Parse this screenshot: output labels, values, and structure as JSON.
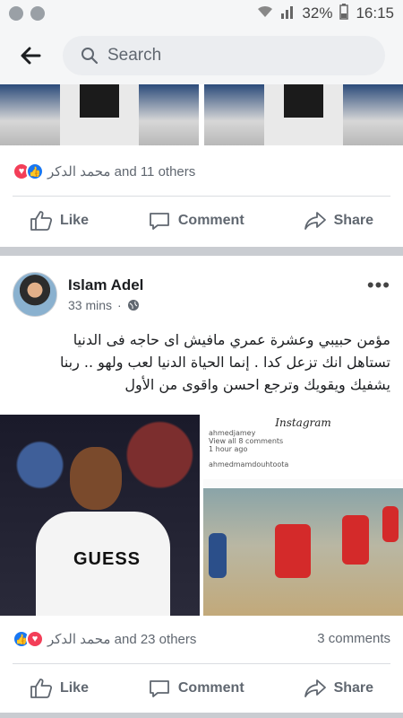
{
  "status_bar": {
    "battery": "32%",
    "time": "16:15"
  },
  "search": {
    "placeholder": "Search"
  },
  "post1": {
    "reactions_text": "محمد الدكر and 11 others"
  },
  "actions": {
    "like": "Like",
    "comment": "Comment",
    "share": "Share"
  },
  "post2": {
    "author": "Islam Adel",
    "time": "33 mins",
    "text_lines": [
      "مؤمن حبيبي وعشرة عمري مافيش اى حاجه فى الدنيا",
      "تستاهل انك تزعل كدا . إنما الحياة الدنيا لعب ولهو .. ربنا",
      "يشفيك ويقويك وترجع احسن واقوى من الأول"
    ],
    "image_left_logo": "GUESS",
    "image_right": {
      "app_name": "Instagram",
      "username1": "ahmedjamey",
      "view_comments": "View all 8 comments",
      "time": "1 hour ago",
      "username2": "ahmedmamdouhtoota"
    },
    "reactions_text": "محمد الدكر and 23 others",
    "comments": "3 comments"
  },
  "colors": {
    "like_blue": "#1877f2",
    "love_red": "#f33e58",
    "separator": "#c9ccd1"
  }
}
